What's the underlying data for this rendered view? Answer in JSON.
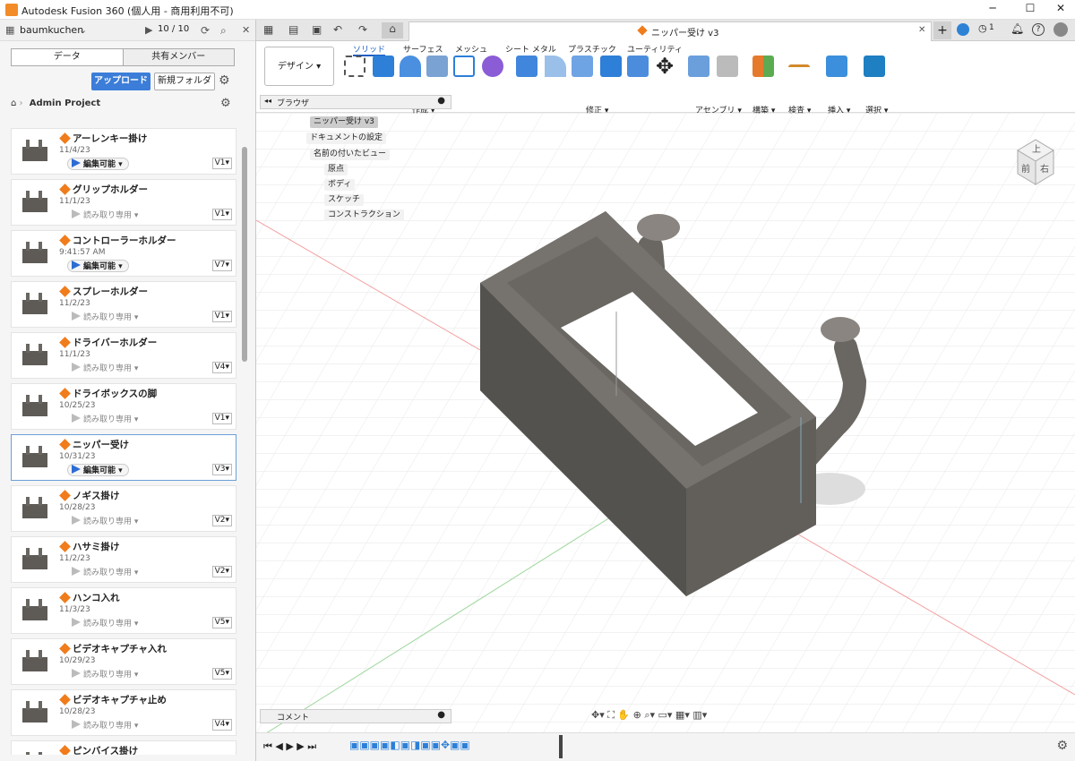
{
  "window": {
    "title": "Autodesk Fusion 360 (個人用 - 商用利用不可)"
  },
  "data_panel": {
    "user": "baumkuchen",
    "doc_count": "10 / 10",
    "tab_data": "データ",
    "tab_members": "共有メンバー",
    "upload_label": "アップロード",
    "new_folder_label": "新規フォルダ",
    "breadcrumb": "Admin Project",
    "files": [
      {
        "name": "アーレンキー掛け",
        "date": "11/4/23",
        "status": "編集可能",
        "editable": true,
        "version": "V1▾"
      },
      {
        "name": "グリップホルダー",
        "date": "11/1/23",
        "status": "読み取り専用",
        "editable": false,
        "version": "V1▾"
      },
      {
        "name": "コントローラーホルダー",
        "date": "9:41:57 AM",
        "status": "編集可能",
        "editable": true,
        "version": "V7▾"
      },
      {
        "name": "スプレーホルダー",
        "date": "11/2/23",
        "status": "読み取り専用",
        "editable": false,
        "version": "V1▾"
      },
      {
        "name": "ドライバーホルダー",
        "date": "11/1/23",
        "status": "読み取り専用",
        "editable": false,
        "version": "V4▾"
      },
      {
        "name": "ドライボックスの脚",
        "date": "10/25/23",
        "status": "読み取り専用",
        "editable": false,
        "version": "V1▾"
      },
      {
        "name": "ニッパー受け",
        "date": "10/31/23",
        "status": "編集可能",
        "editable": true,
        "version": "V3▾",
        "selected": true
      },
      {
        "name": "ノギス掛け",
        "date": "10/28/23",
        "status": "読み取り専用",
        "editable": false,
        "version": "V2▾"
      },
      {
        "name": "ハサミ掛け",
        "date": "11/2/23",
        "status": "読み取り専用",
        "editable": false,
        "version": "V2▾"
      },
      {
        "name": "ハンコ入れ",
        "date": "11/3/23",
        "status": "読み取り専用",
        "editable": false,
        "version": "V5▾"
      },
      {
        "name": "ビデオキャプチャ入れ",
        "date": "10/29/23",
        "status": "読み取り専用",
        "editable": false,
        "version": "V5▾"
      },
      {
        "name": "ビデオキャプチャ止め",
        "date": "10/28/23",
        "status": "読み取り専用",
        "editable": false,
        "version": "V4▾"
      },
      {
        "name": "ピンバイス掛け",
        "date": "",
        "status": "",
        "editable": false,
        "version": ""
      }
    ]
  },
  "document": {
    "tab_title": "ニッパー受け v3"
  },
  "ribbon": {
    "workspace": "デザイン ▾",
    "tabs": [
      "ソリッド",
      "サーフェス",
      "メッシュ",
      "シート メタル",
      "プラスチック",
      "ユーティリティ"
    ],
    "groups": [
      "作成 ▾",
      "修正 ▾",
      "アセンブリ ▾",
      "構築 ▾",
      "検査 ▾",
      "挿入 ▾",
      "選択 ▾"
    ]
  },
  "browser": {
    "title": "ブラウザ",
    "root": "ニッパー受け v3",
    "nodes": [
      "ドキュメントの設定",
      "名前の付いたビュー",
      "原点",
      "ボディ",
      "スケッチ",
      "コンストラクション"
    ]
  },
  "comment_label": "コメント",
  "viewcube": {
    "top": "上",
    "front": "前",
    "right": "右"
  },
  "notifications": "1"
}
